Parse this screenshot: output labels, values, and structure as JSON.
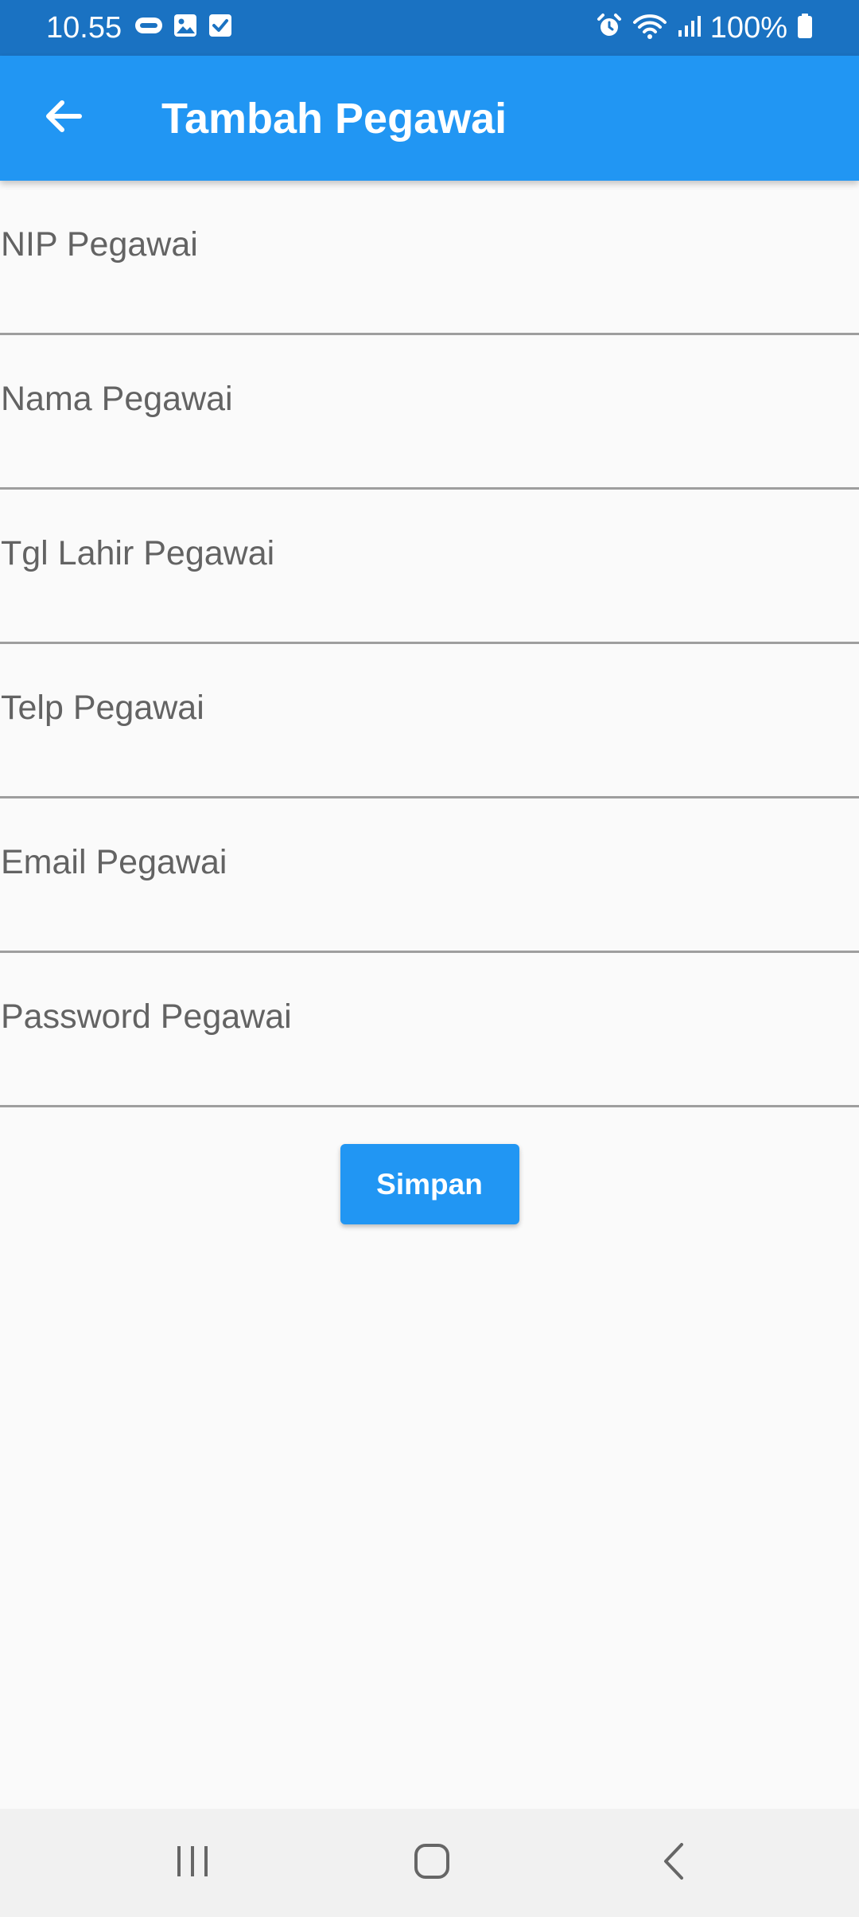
{
  "status_bar": {
    "time": "10.55",
    "battery": "100%",
    "icons_left": [
      "axis-icon",
      "image-icon",
      "checkbox-icon"
    ],
    "icons_right": [
      "alarm-icon",
      "wifi-icon",
      "signal-icon",
      "battery-icon"
    ]
  },
  "app_bar": {
    "title": "Tambah Pegawai",
    "back_icon": "arrow-back-icon",
    "color": "#2196f3"
  },
  "form": {
    "fields": [
      {
        "placeholder": "NIP Pegawai",
        "value": ""
      },
      {
        "placeholder": "Nama Pegawai",
        "value": ""
      },
      {
        "placeholder": "Tgl Lahir Pegawai",
        "value": ""
      },
      {
        "placeholder": "Telp Pegawai",
        "value": ""
      },
      {
        "placeholder": "Email Pegawai",
        "value": ""
      },
      {
        "placeholder": "Password Pegawai",
        "value": ""
      }
    ],
    "save_label": "Simpan"
  },
  "nav_bar": {
    "icons": [
      "recent-apps-icon",
      "home-icon",
      "back-icon"
    ]
  }
}
